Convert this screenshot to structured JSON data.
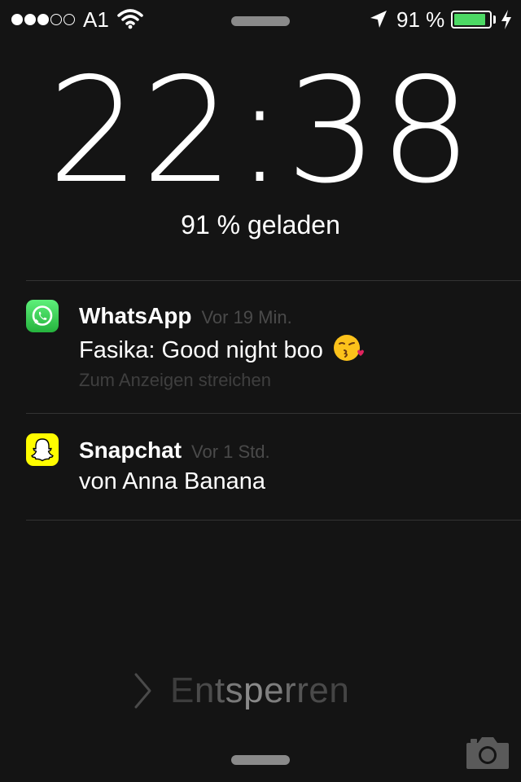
{
  "status_bar": {
    "signal_dots": [
      true,
      true,
      true,
      false,
      false
    ],
    "carrier": "A1",
    "battery_percent": "91 %",
    "battery_level": 0.91,
    "battery_color": "#4cd964"
  },
  "lock_screen": {
    "time": "22:38",
    "charge_status": "91 % geladen"
  },
  "notifications": [
    {
      "app": "WhatsApp",
      "icon": "whatsapp-icon",
      "time": "Vor 19 Min.",
      "message": "Fasika: Good night boo",
      "emoji": "face-blowing-kiss",
      "hint": "Zum Anzeigen streichen"
    },
    {
      "app": "Snapchat",
      "icon": "snapchat-ghost-icon",
      "time": "Vor 1 Std.",
      "message": "von Anna Banana"
    }
  ],
  "unlock": {
    "label": "Entsperren"
  },
  "icons": [
    "wifi-icon",
    "location-arrow-icon",
    "charging-bolt-icon",
    "camera-icon",
    "chevron-right-icon"
  ]
}
